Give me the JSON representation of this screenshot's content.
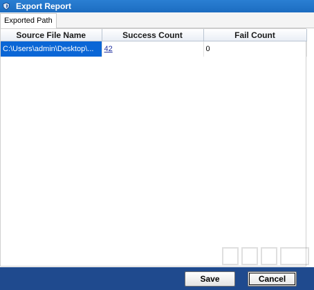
{
  "window": {
    "title": "Export Report"
  },
  "tabs": [
    {
      "label": "Exported Path"
    }
  ],
  "table": {
    "columns": [
      "Source File Name",
      "Success Count",
      "Fail Count"
    ],
    "rows": [
      {
        "source": "C:\\Users\\admin\\Desktop\\...",
        "success": "42",
        "fail": "0"
      }
    ]
  },
  "footer": {
    "save_label": "Save",
    "cancel_label": "Cancel"
  },
  "colors": {
    "titlebar": "#1c6cc0",
    "selection": "#0a66d6",
    "footer": "#1f4a8e"
  },
  "icons": {
    "title": "shield-icon"
  }
}
